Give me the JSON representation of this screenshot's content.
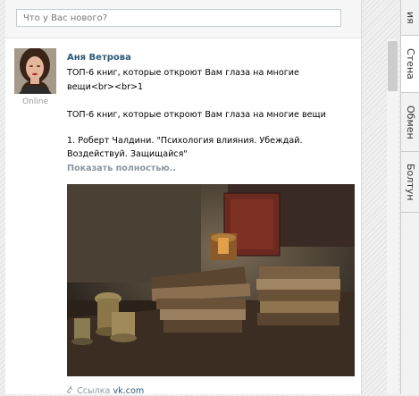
{
  "status": {
    "placeholder": "Что у Вас нового?"
  },
  "post": {
    "author": "Аня Ветрова",
    "online": "Online",
    "line1": "ТОП-6 книг, которые откроют Вам глаза на многие",
    "line2": "вещи<br><br>1",
    "line3": "ТОП-6 книг, которые откроют Вам глаза на многие вещи",
    "line4": "1. Роберт Чалдини. \"Психология влияния. Убеждай.",
    "line5": "Воздействуй. Защищайся\"",
    "show_more": "Показать полностью..",
    "link_label": "Ссылка",
    "link_domain": "vk.com"
  },
  "tabs": [
    "ия",
    "Стена",
    "Обмен",
    "Болтун"
  ],
  "icons": [
    "link-icon"
  ]
}
